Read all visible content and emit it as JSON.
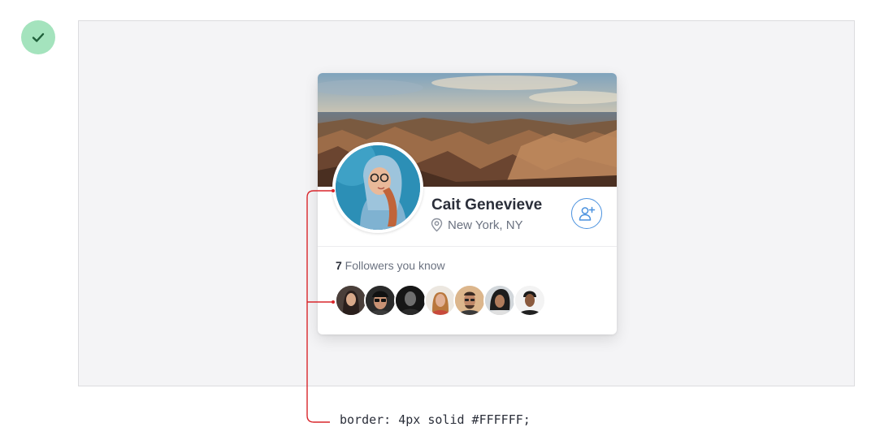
{
  "status": {
    "icon": "check-icon",
    "color": "#a4e3bd"
  },
  "profile": {
    "name": "Cait Genevieve",
    "location": "New York, NY",
    "location_icon": "location-pin-icon",
    "follow_icon": "add-user-icon"
  },
  "followers": {
    "count": "7",
    "label": " Followers you know"
  },
  "annotation": {
    "code": "border: 4px solid #FFFFFF;",
    "color": "#d9262b"
  },
  "colors": {
    "accent": "#4b92df",
    "card_bg": "#FFFFFF",
    "canvas_bg": "#f4f4f6"
  }
}
